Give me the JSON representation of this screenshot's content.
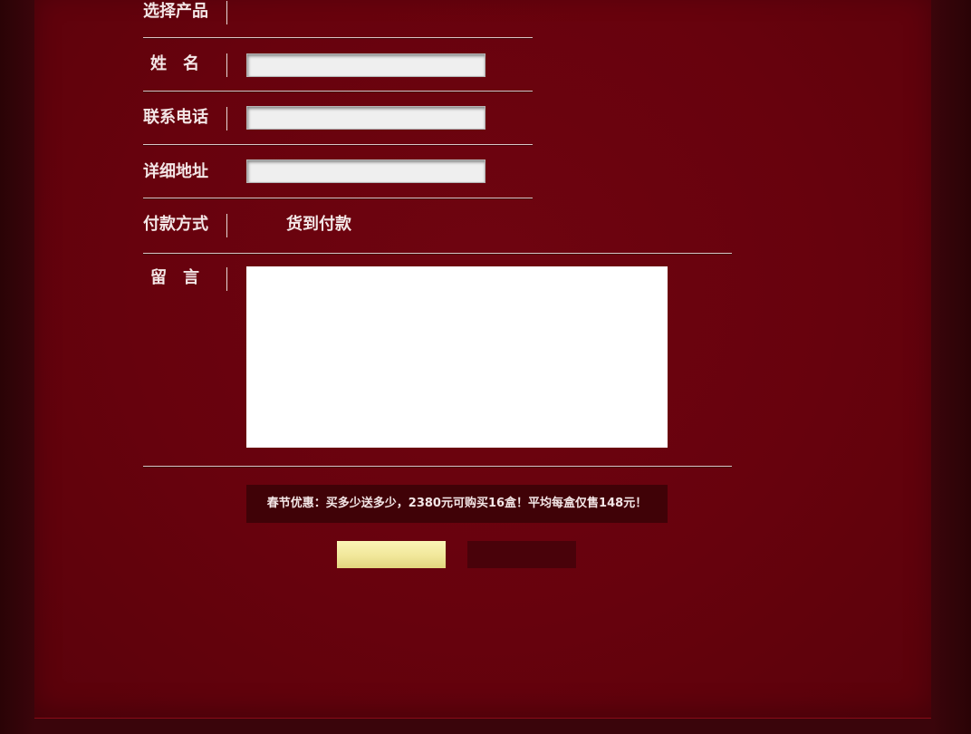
{
  "form": {
    "product_label": "选择产品",
    "name_label": "姓　名",
    "phone_label": "联系电话",
    "address_label": "详细地址",
    "payment_label": "付款方式",
    "payment_value": "货到付款",
    "message_label": "留　言",
    "name_value": "",
    "phone_value": "",
    "address_value": "",
    "message_value": ""
  },
  "promo": {
    "text": "春节优惠：买多少送多少，2380元可购买16盒！平均每盒仅售148元！"
  },
  "buttons": {
    "submit_label": "",
    "reset_label": ""
  },
  "colors": {
    "background": "#67020d",
    "label_text": "#f3e6e6",
    "submit_button": "#f1e79a",
    "reset_button": "#49020a",
    "promo_background": "#400207"
  }
}
